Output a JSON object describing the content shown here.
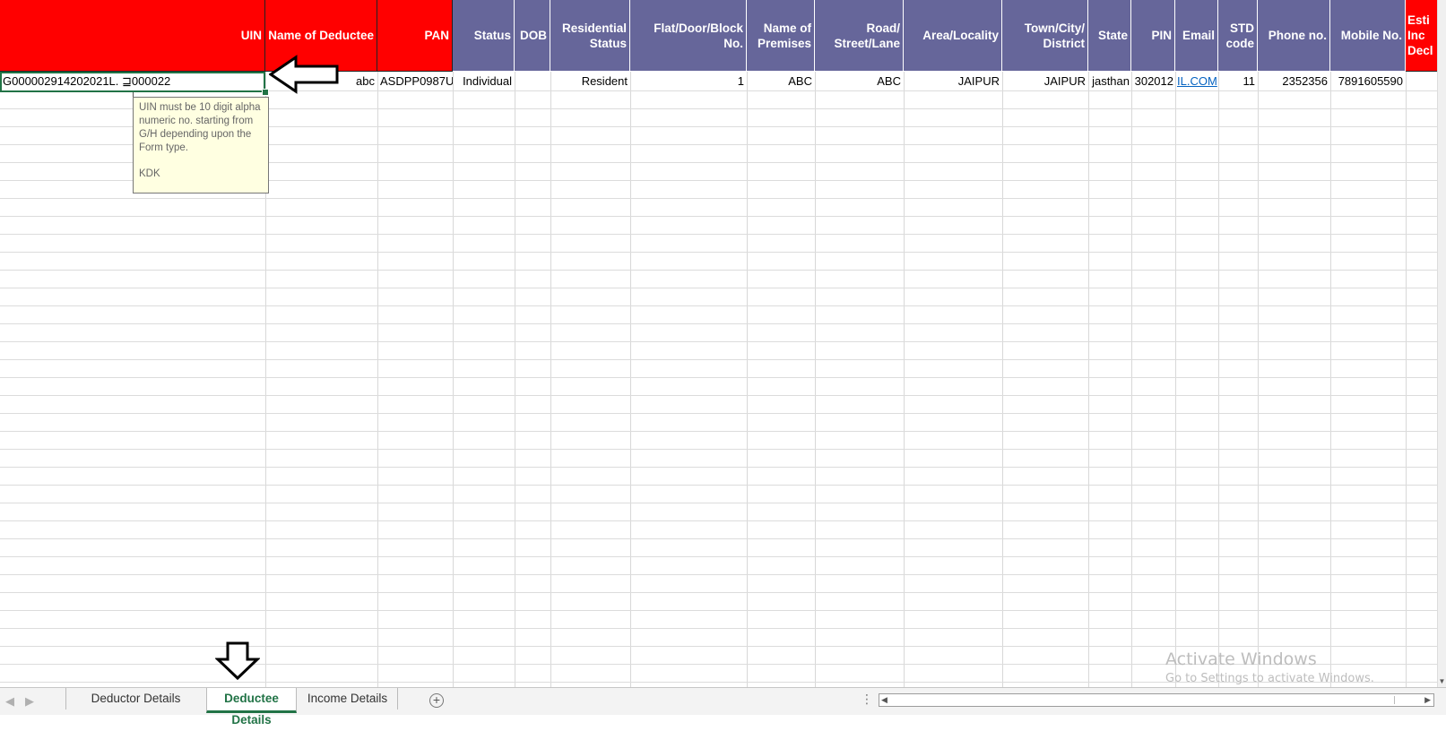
{
  "colors": {
    "red_header": "#ff0000",
    "blue_header": "#66669a",
    "active_tab": "#217346",
    "link": "#0563c1",
    "comment_bg": "#ffffe1"
  },
  "headers": [
    "UIN",
    "Name of Deductee",
    "PAN",
    "Status",
    "DOB",
    "Residential Status",
    "Flat/Door/Block No.",
    "Name of Premises",
    "Road/ Street/Lane",
    "Area/Locality",
    "Town/City/ District",
    "State",
    "PIN",
    "Email",
    "STD code",
    "Phone no.",
    "Mobile No.",
    "Esti Inc Decl"
  ],
  "row1": {
    "uin": "G000002914202021L. ⊒000022",
    "name": "abc",
    "pan": "ASDPP0987U",
    "status": "Individual",
    "dob": "",
    "residential_status": "Resident",
    "flat": "1",
    "premises": "ABC",
    "road": "ABC",
    "area": "JAIPUR",
    "town": "JAIPUR",
    "state": "jasthan",
    "pin": "302012",
    "email": "IL.COM",
    "std": "11",
    "phone": "2352356",
    "mobile": "7891605590"
  },
  "comment": {
    "text": "UIN must be 10 digit alpha numeric no. starting from G/H depending upon the Form type.",
    "author": "KDK"
  },
  "sheets": [
    "Deductor Details",
    "Deductee Details",
    "Income Details"
  ],
  "active_sheet": "Deductee Details",
  "watermark": {
    "title": "Activate Windows",
    "subtitle": "Go to Settings to activate Windows."
  },
  "icons": {
    "add_sheet": "plus-circle-icon",
    "left_arrow": "left-arrow-annotation-icon",
    "down_arrow": "down-arrow-annotation-icon"
  }
}
